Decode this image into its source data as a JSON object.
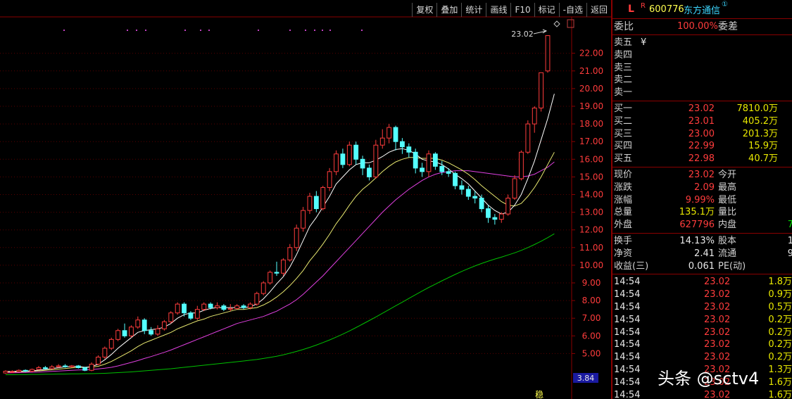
{
  "toolbar": {
    "items": [
      "复权",
      "叠加",
      "统计",
      "画线",
      "F10",
      "标记",
      "-自选",
      "返回"
    ]
  },
  "chart": {
    "high_label": "23.02",
    "price_ticks": [
      "22.00",
      "21.00",
      "20.00",
      "19.00",
      "18.00",
      "17.00",
      "16.00",
      "15.00",
      "14.00",
      "13.00",
      "12.00",
      "11.00",
      "10.00",
      "9.00",
      "8.00",
      "7.00",
      "6.00",
      "5.00"
    ],
    "price_ticks_values": [
      22,
      21,
      20,
      19,
      18,
      17,
      16,
      15,
      14,
      13,
      12,
      11,
      10,
      9,
      8,
      7,
      6,
      5
    ],
    "current_marker": "3.84",
    "bottom_mark": "稳"
  },
  "chart_data": {
    "type": "line",
    "title": "",
    "ylabel": "",
    "ylim": [
      4.1,
      23.9
    ],
    "grid": true,
    "candles": [
      [
        3.9,
        4.0,
        3.85,
        4.05
      ],
      [
        3.95,
        3.98,
        3.9,
        4.05
      ],
      [
        3.98,
        4.05,
        3.95,
        4.1
      ],
      [
        4.05,
        4.02,
        3.95,
        4.1
      ],
      [
        4.0,
        4.1,
        3.95,
        4.15
      ],
      [
        4.1,
        4.2,
        4.05,
        4.3
      ],
      [
        4.2,
        4.15,
        4.1,
        4.3
      ],
      [
        4.15,
        4.25,
        4.1,
        4.35
      ],
      [
        4.25,
        4.3,
        4.2,
        4.4
      ],
      [
        4.3,
        4.25,
        4.2,
        4.4
      ],
      [
        4.25,
        4.3,
        4.2,
        4.35
      ],
      [
        4.3,
        4.2,
        4.15,
        4.35
      ],
      [
        4.2,
        4.05,
        4.0,
        4.25
      ],
      [
        4.05,
        4.4,
        4.0,
        4.5
      ],
      [
        4.4,
        4.8,
        4.35,
        4.9
      ],
      [
        4.8,
        5.3,
        4.7,
        5.4
      ],
      [
        5.3,
        5.8,
        5.2,
        5.9
      ],
      [
        5.8,
        6.3,
        5.7,
        6.4
      ],
      [
        6.3,
        6.0,
        5.9,
        6.7
      ],
      [
        6.0,
        6.5,
        5.9,
        6.6
      ],
      [
        6.5,
        6.9,
        6.4,
        7.1
      ],
      [
        6.9,
        6.3,
        6.1,
        7.0
      ],
      [
        6.3,
        6.1,
        6.0,
        6.5
      ],
      [
        6.1,
        6.4,
        6.0,
        6.6
      ],
      [
        6.4,
        6.8,
        6.3,
        6.9
      ],
      [
        6.8,
        7.3,
        6.7,
        7.4
      ],
      [
        7.3,
        7.8,
        7.2,
        7.9
      ],
      [
        7.8,
        7.3,
        7.1,
        7.9
      ],
      [
        7.3,
        7.0,
        6.9,
        7.4
      ],
      [
        7.0,
        7.5,
        6.9,
        7.7
      ],
      [
        7.5,
        7.8,
        7.4,
        7.9
      ],
      [
        7.8,
        7.6,
        7.5,
        7.9
      ],
      [
        7.6,
        7.7,
        7.5,
        7.9
      ],
      [
        7.7,
        7.5,
        7.4,
        7.8
      ],
      [
        7.5,
        7.55,
        7.4,
        7.8
      ],
      [
        7.55,
        7.7,
        7.5,
        7.8
      ],
      [
        7.7,
        7.6,
        7.5,
        7.8
      ],
      [
        7.6,
        7.8,
        7.5,
        7.9
      ],
      [
        7.8,
        8.4,
        7.7,
        8.5
      ],
      [
        8.4,
        9.0,
        8.3,
        9.1
      ],
      [
        9.0,
        9.6,
        8.9,
        9.7
      ],
      [
        9.6,
        9.55,
        9.4,
        10.2
      ],
      [
        9.55,
        10.3,
        9.4,
        10.4
      ],
      [
        10.3,
        11.0,
        10.2,
        11.2
      ],
      [
        11.0,
        12.1,
        10.8,
        12.3
      ],
      [
        12.1,
        13.1,
        11.9,
        13.3
      ],
      [
        13.1,
        13.9,
        12.9,
        14.1
      ],
      [
        13.9,
        13.2,
        13.0,
        14.2
      ],
      [
        13.2,
        14.4,
        13.1,
        14.5
      ],
      [
        14.4,
        15.3,
        14.2,
        15.5
      ],
      [
        15.3,
        16.3,
        15.1,
        16.5
      ],
      [
        16.3,
        15.7,
        15.5,
        16.6
      ],
      [
        15.7,
        16.8,
        15.6,
        17.0
      ],
      [
        16.8,
        16.0,
        15.7,
        17.0
      ],
      [
        16.0,
        15.5,
        15.1,
        16.2
      ],
      [
        15.5,
        15.0,
        14.8,
        15.7
      ],
      [
        15.0,
        16.8,
        14.9,
        17.1
      ],
      [
        16.8,
        17.2,
        16.6,
        17.7
      ],
      [
        17.2,
        17.8,
        16.9,
        18.0
      ],
      [
        17.8,
        17.0,
        16.5,
        17.9
      ],
      [
        17.0,
        16.7,
        16.3,
        17.2
      ],
      [
        16.7,
        16.4,
        16.1,
        16.9
      ],
      [
        16.4,
        15.5,
        15.2,
        16.6
      ],
      [
        15.5,
        15.3,
        15.0,
        15.8
      ],
      [
        15.3,
        16.3,
        15.0,
        16.5
      ],
      [
        16.3,
        15.6,
        15.4,
        16.4
      ],
      [
        15.6,
        15.3,
        15.1,
        15.9
      ],
      [
        15.3,
        15.2,
        15.0,
        15.5
      ],
      [
        15.2,
        14.5,
        14.3,
        15.3
      ],
      [
        14.5,
        14.3,
        14.0,
        14.8
      ],
      [
        14.3,
        13.9,
        13.7,
        14.5
      ],
      [
        13.9,
        13.8,
        13.5,
        14.2
      ],
      [
        13.8,
        13.2,
        13.0,
        14.0
      ],
      [
        13.2,
        12.7,
        12.4,
        13.4
      ],
      [
        12.7,
        12.6,
        12.3,
        12.9
      ],
      [
        12.6,
        12.9,
        12.4,
        13.0
      ],
      [
        12.9,
        13.8,
        12.8,
        14.0
      ],
      [
        13.8,
        14.9,
        13.7,
        15.1
      ],
      [
        14.9,
        16.4,
        14.8,
        16.5
      ],
      [
        16.4,
        18.0,
        16.3,
        18.2
      ],
      [
        18.0,
        18.9,
        17.5,
        19.0
      ],
      [
        18.9,
        20.9,
        18.7,
        20.9
      ],
      [
        21.0,
        23.0,
        20.9,
        23.02
      ]
    ],
    "ma_white": [
      3.98,
      3.99,
      4.0,
      4.01,
      4.02,
      4.06,
      4.1,
      4.15,
      4.2,
      4.25,
      4.27,
      4.27,
      4.22,
      4.26,
      4.4,
      4.65,
      4.95,
      5.3,
      5.6,
      5.9,
      6.2,
      6.3,
      6.35,
      6.4,
      6.5,
      6.7,
      7.0,
      7.2,
      7.3,
      7.3,
      7.45,
      7.55,
      7.6,
      7.6,
      7.6,
      7.6,
      7.6,
      7.65,
      7.8,
      8.1,
      8.5,
      8.95,
      9.35,
      9.9,
      10.6,
      11.4,
      12.2,
      12.7,
      13.3,
      13.9,
      14.6,
      15.0,
      15.4,
      15.7,
      15.8,
      15.8,
      15.95,
      16.15,
      16.4,
      16.55,
      16.6,
      16.5,
      16.3,
      16.0,
      15.9,
      15.85,
      15.7,
      15.45,
      15.15,
      14.9,
      14.6,
      14.2,
      13.8,
      13.4,
      13.1,
      12.9,
      13.0,
      13.4,
      14.0,
      14.9,
      15.9,
      17.1,
      18.3,
      19.7
    ],
    "ma_yellow": [
      3.95,
      3.96,
      3.97,
      3.98,
      4.0,
      4.02,
      4.05,
      4.08,
      4.12,
      4.15,
      4.19,
      4.22,
      4.22,
      4.23,
      4.28,
      4.4,
      4.55,
      4.75,
      4.95,
      5.15,
      5.4,
      5.6,
      5.75,
      5.9,
      6.05,
      6.2,
      6.4,
      6.55,
      6.7,
      6.85,
      6.95,
      7.1,
      7.2,
      7.3,
      7.4,
      7.5,
      7.5,
      7.55,
      7.6,
      7.75,
      7.95,
      8.2,
      8.5,
      8.85,
      9.25,
      9.7,
      10.25,
      10.7,
      11.2,
      11.75,
      12.35,
      12.85,
      13.4,
      13.9,
      14.3,
      14.6,
      14.95,
      15.3,
      15.6,
      15.85,
      16.0,
      16.1,
      16.1,
      16.05,
      16.05,
      16.05,
      15.95,
      15.8,
      15.6,
      15.4,
      15.15,
      14.85,
      14.5,
      14.2,
      13.9,
      13.6,
      13.4,
      13.35,
      13.5,
      13.9,
      14.4,
      15.0,
      15.7,
      16.4
    ],
    "ma_magenta": [
      3.9,
      3.91,
      3.92,
      3.93,
      3.94,
      3.95,
      3.97,
      3.99,
      4.01,
      4.03,
      4.05,
      4.07,
      4.08,
      4.1,
      4.13,
      4.17,
      4.22,
      4.3,
      4.4,
      4.5,
      4.6,
      4.72,
      4.83,
      4.95,
      5.07,
      5.2,
      5.35,
      5.5,
      5.65,
      5.8,
      5.95,
      6.1,
      6.25,
      6.4,
      6.55,
      6.7,
      6.8,
      6.9,
      7.0,
      7.1,
      7.25,
      7.4,
      7.6,
      7.8,
      8.05,
      8.35,
      8.7,
      9.05,
      9.4,
      9.8,
      10.2,
      10.6,
      11.0,
      11.4,
      11.8,
      12.2,
      12.6,
      13.0,
      13.35,
      13.7,
      14.0,
      14.3,
      14.55,
      14.8,
      15.0,
      15.15,
      15.25,
      15.3,
      15.35,
      15.35,
      15.35,
      15.3,
      15.25,
      15.2,
      15.15,
      15.1,
      15.05,
      15.0,
      15.0,
      15.05,
      15.15,
      15.35,
      15.55,
      15.85
    ],
    "ma_green": [
      3.8,
      3.8,
      3.81,
      3.81,
      3.82,
      3.82,
      3.83,
      3.83,
      3.84,
      3.84,
      3.85,
      3.85,
      3.86,
      3.86,
      3.87,
      3.88,
      3.9,
      3.92,
      3.94,
      3.96,
      3.99,
      4.02,
      4.05,
      4.08,
      4.11,
      4.14,
      4.18,
      4.22,
      4.26,
      4.3,
      4.34,
      4.38,
      4.42,
      4.46,
      4.5,
      4.54,
      4.58,
      4.62,
      4.66,
      4.72,
      4.78,
      4.85,
      4.93,
      5.02,
      5.12,
      5.23,
      5.35,
      5.48,
      5.62,
      5.77,
      5.93,
      6.1,
      6.28,
      6.47,
      6.67,
      6.87,
      7.07,
      7.28,
      7.49,
      7.7,
      7.91,
      8.12,
      8.33,
      8.54,
      8.74,
      8.93,
      9.12,
      9.3,
      9.48,
      9.65,
      9.81,
      9.96,
      10.1,
      10.23,
      10.35,
      10.46,
      10.58,
      10.7,
      10.84,
      11.0,
      11.17,
      11.36,
      11.56,
      11.78
    ]
  },
  "panel": {
    "badge_l": "L",
    "badge_r": "R",
    "code": "600776",
    "name": "东方通信",
    "name_sup": "①",
    "weibi_label": "委比",
    "weibi_value": "100.00%",
    "weicha_label": "委差",
    "asks": [
      {
        "label": "卖五",
        "unit": "¥"
      },
      {
        "label": "卖四",
        "unit": ""
      },
      {
        "label": "卖三",
        "unit": ""
      },
      {
        "label": "卖二",
        "unit": ""
      },
      {
        "label": "卖一",
        "unit": ""
      }
    ],
    "bids": [
      {
        "label": "买一",
        "price": "23.02",
        "vol": "7810.0万"
      },
      {
        "label": "买二",
        "price": "23.01",
        "vol": "405.2万"
      },
      {
        "label": "买三",
        "price": "23.00",
        "vol": "201.3万"
      },
      {
        "label": "买四",
        "price": "22.99",
        "vol": "15.9万"
      },
      {
        "label": "买五",
        "price": "22.98",
        "vol": "40.7万"
      }
    ],
    "stats1": [
      {
        "l": "现价",
        "v": "23.02",
        "l2": "今开",
        "v2": ""
      },
      {
        "l": "涨跌",
        "v": "2.09",
        "l2": "最高",
        "v2": ""
      },
      {
        "l": "涨幅",
        "v": "9.99%",
        "l2": "最低",
        "v2": ""
      },
      {
        "l": "总量",
        "v": "135.1万",
        "l2": "量比",
        "v2": ""
      },
      {
        "l": "外盘",
        "v": "627796",
        "l2": "内盘",
        "v2": "7"
      }
    ],
    "stats2": [
      {
        "l": "换手",
        "v": "14.13%",
        "l2": "股本",
        "v2": "1"
      },
      {
        "l": "净资",
        "v": "2.41",
        "l2": "流通",
        "v2": "9"
      },
      {
        "l": "收益(三)",
        "v": "0.061",
        "l2": "PE(动)",
        "v2": ""
      }
    ],
    "ticks": [
      {
        "t": "14:54",
        "p": "23.02",
        "v": "1.8万"
      },
      {
        "t": "14:54",
        "p": "23.02",
        "v": "0.9万"
      },
      {
        "t": "14:54",
        "p": "23.02",
        "v": "0.5万"
      },
      {
        "t": "14:54",
        "p": "23.02",
        "v": "0.2万"
      },
      {
        "t": "14:54",
        "p": "23.02",
        "v": "0.2万"
      },
      {
        "t": "14:54",
        "p": "23.02",
        "v": "0.2万"
      },
      {
        "t": "14:54",
        "p": "23.02",
        "v": "0.2万"
      },
      {
        "t": "14:54",
        "p": "23.02",
        "v": "1.3万"
      },
      {
        "t": "14:54",
        "p": "23.02",
        "v": "1.6万"
      },
      {
        "t": "14:54",
        "p": "23.02",
        "v": "1.6万"
      }
    ]
  },
  "watermark": "头条 @sctv4",
  "colors": {
    "up": "#ff3c3c",
    "down": "#54ffff",
    "ma5": "#ffffff",
    "ma10": "#e8e870",
    "ma20": "#e040e0",
    "ma60": "#00c000",
    "border": "#8a0000"
  }
}
